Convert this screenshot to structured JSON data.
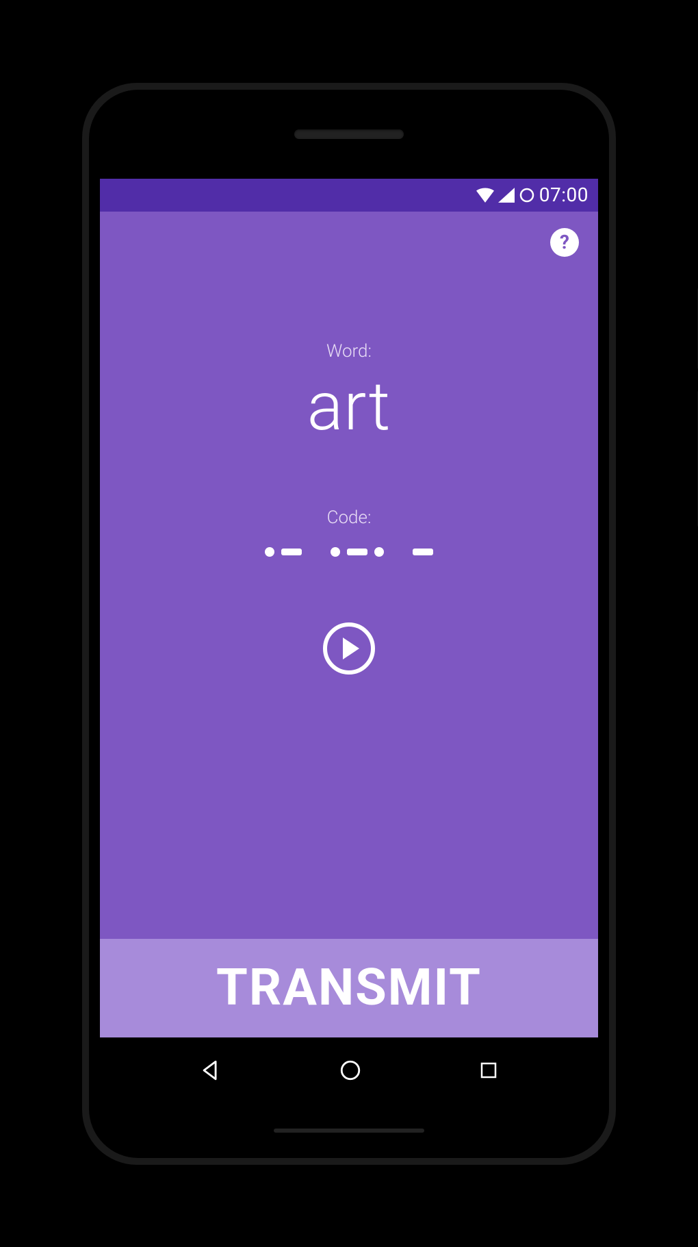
{
  "status": {
    "time": "07:00"
  },
  "app": {
    "word_label": "Word:",
    "word_value": "art",
    "code_label": "Code:",
    "morse": [
      [
        ".",
        "-"
      ],
      [
        ".",
        "-",
        "."
      ],
      [
        "-"
      ]
    ],
    "transmit_label": "TRANSMIT",
    "help_symbol": "?"
  }
}
